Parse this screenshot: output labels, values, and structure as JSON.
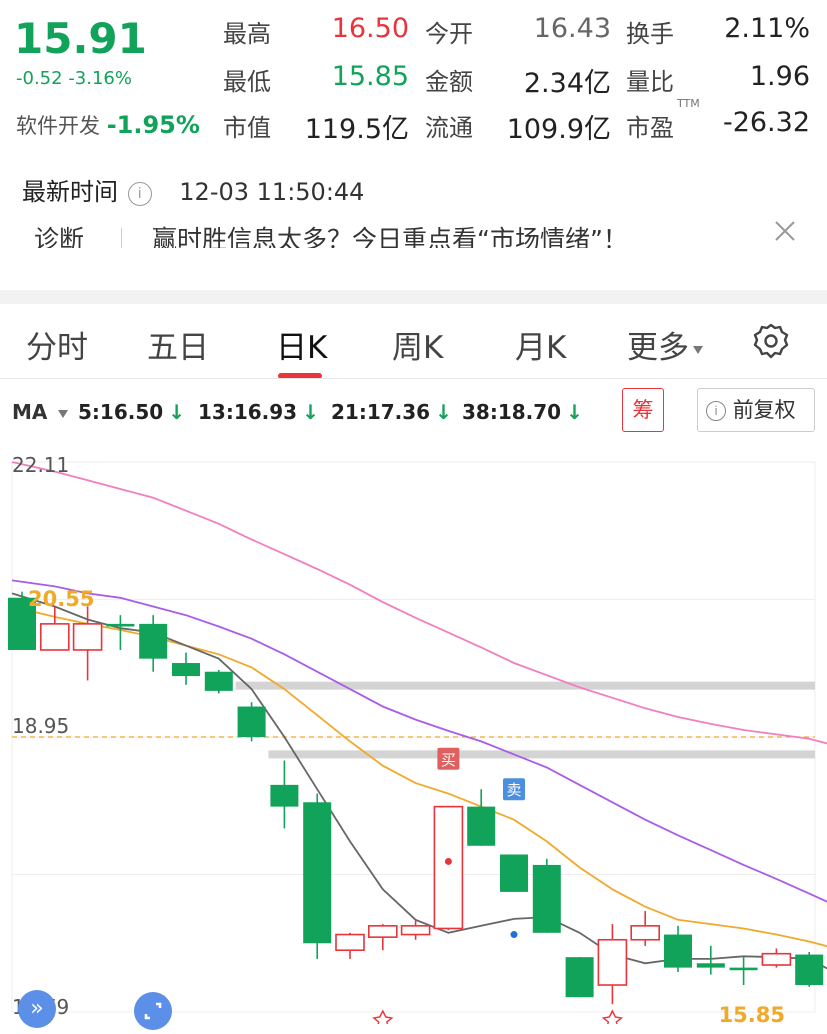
{
  "quote": {
    "price": "15.91",
    "change": "-0.52",
    "change_pct": "-3.16%",
    "sector_name": "软件开发",
    "sector_change": "-1.95%",
    "grid": [
      {
        "label": "最高",
        "value": "16.50",
        "tone": "red"
      },
      {
        "label": "今开",
        "value": "16.43",
        "tone": "grey"
      },
      {
        "label": "换手",
        "value": "2.11%",
        "tone": "dark"
      },
      {
        "label": "最低",
        "value": "15.85",
        "tone": "green"
      },
      {
        "label": "金额",
        "value": "2.34亿",
        "tone": "dark"
      },
      {
        "label": "量比",
        "value": "1.96",
        "tone": "dark"
      },
      {
        "label": "市值",
        "value": "119.5亿",
        "tone": "dark"
      },
      {
        "label": "流通",
        "value": "109.9亿",
        "tone": "dark"
      },
      {
        "label": "市盈",
        "value": "-26.32",
        "tone": "dark"
      }
    ],
    "pe_suffix": "TTM"
  },
  "latest_time": {
    "label": "最新时间",
    "value": "12-03 11:50:44"
  },
  "notice": {
    "tag": "诊断",
    "text": "赢时胜信息太多？今日重点看“市场情绪”！"
  },
  "tabs": [
    "分时",
    "五日",
    "日K",
    "周K",
    "月K",
    "更多"
  ],
  "active_tab": 2,
  "ma_bar": {
    "label": "MA",
    "items": [
      {
        "text": "5:16.50",
        "color": "#333333"
      },
      {
        "text": "13:16.93",
        "color": "#f0a92a"
      },
      {
        "text": "21:17.36",
        "color": "#a95ce6"
      },
      {
        "text": "38:18.70",
        "color": "#f07fc0"
      }
    ],
    "chip_label": "筹",
    "fq_label": "前复权"
  },
  "chart_data": {
    "type": "candlestick",
    "y_axis_ticks": [
      "22.11",
      "18.95",
      "15.79"
    ],
    "ylim": [
      15.79,
      22.11
    ],
    "max_label": "20.55",
    "min_label": "15.85",
    "reference_line": 18.95,
    "up_color": "#e8343a",
    "down_color": "#11a35a",
    "candles": [
      {
        "o": 20.55,
        "h": 20.62,
        "c": 19.95,
        "l": 19.95
      },
      {
        "o": 19.95,
        "h": 20.45,
        "c": 20.25,
        "l": 19.95
      },
      {
        "o": 19.95,
        "h": 20.45,
        "c": 20.25,
        "l": 19.6
      },
      {
        "o": 20.25,
        "h": 20.35,
        "c": 20.22,
        "l": 19.95
      },
      {
        "o": 20.25,
        "h": 20.35,
        "c": 19.85,
        "l": 19.7
      },
      {
        "o": 19.8,
        "h": 19.92,
        "c": 19.65,
        "l": 19.55
      },
      {
        "o": 19.7,
        "h": 19.72,
        "c": 19.48,
        "l": 19.45
      },
      {
        "o": 19.3,
        "h": 19.35,
        "c": 18.95,
        "l": 18.9
      },
      {
        "o": 18.4,
        "h": 18.68,
        "c": 18.15,
        "l": 17.9
      },
      {
        "o": 18.2,
        "h": 18.3,
        "c": 16.58,
        "l": 16.4
      },
      {
        "o": 16.5,
        "h": 16.7,
        "c": 16.68,
        "l": 16.4
      },
      {
        "o": 16.65,
        "h": 16.8,
        "c": 16.78,
        "l": 16.5
      },
      {
        "o": 16.68,
        "h": 16.84,
        "c": 16.78,
        "l": 16.62
      },
      {
        "o": 16.75,
        "h": 18.15,
        "c": 18.15,
        "l": 16.73
      },
      {
        "o": 18.15,
        "h": 18.35,
        "c": 17.7,
        "l": 17.7
      },
      {
        "o": 17.6,
        "h": 17.6,
        "c": 17.17,
        "l": 17.17
      },
      {
        "o": 17.48,
        "h": 17.55,
        "c": 16.7,
        "l": 16.7
      },
      {
        "o": 16.42,
        "h": 16.42,
        "c": 15.96,
        "l": 15.96
      },
      {
        "o": 16.1,
        "h": 16.8,
        "c": 16.62,
        "l": 15.88
      },
      {
        "o": 16.62,
        "h": 16.95,
        "c": 16.78,
        "l": 16.55
      },
      {
        "o": 16.68,
        "h": 16.78,
        "c": 16.3,
        "l": 16.25
      },
      {
        "o": 16.35,
        "h": 16.55,
        "c": 16.3,
        "l": 16.22
      },
      {
        "o": 16.3,
        "h": 16.42,
        "c": 16.27,
        "l": 16.1
      },
      {
        "o": 16.33,
        "h": 16.52,
        "c": 16.46,
        "l": 16.3
      },
      {
        "o": 16.45,
        "h": 16.48,
        "c": 16.1,
        "l": 16.08
      },
      {
        "o": 15.95,
        "h": 16.05,
        "c": 15.5,
        "l": 15.5
      }
    ],
    "ma5": [
      20.6,
      20.45,
      20.3,
      20.2,
      20.15,
      20.0,
      19.85,
      19.5,
      18.95,
      18.35,
      17.75,
      17.2,
      16.85,
      16.7,
      16.78,
      16.86,
      16.88,
      16.7,
      16.45,
      16.35,
      16.4,
      16.4,
      16.43,
      16.42,
      16.4,
      16.2
    ],
    "ma13": [
      20.45,
      20.33,
      20.25,
      20.18,
      20.1,
      20.0,
      19.9,
      19.75,
      19.5,
      19.2,
      18.9,
      18.62,
      18.42,
      18.3,
      18.15,
      18.0,
      17.75,
      17.45,
      17.2,
      17.0,
      16.85,
      16.8,
      16.75,
      16.68,
      16.6,
      16.5
    ],
    "ma21": [
      20.75,
      20.68,
      20.6,
      20.55,
      20.45,
      20.35,
      20.22,
      20.08,
      19.9,
      19.7,
      19.5,
      19.3,
      19.15,
      19.02,
      18.9,
      18.75,
      18.6,
      18.4,
      18.2,
      18.0,
      17.82,
      17.65,
      17.48,
      17.32,
      17.15,
      16.98
    ],
    "ma38": [
      22.11,
      22.0,
      21.9,
      21.8,
      21.7,
      21.55,
      21.4,
      21.22,
      21.05,
      20.88,
      20.7,
      20.5,
      20.32,
      20.15,
      19.98,
      19.8,
      19.66,
      19.52,
      19.4,
      19.28,
      19.18,
      19.1,
      19.03,
      18.98,
      18.93,
      18.83
    ],
    "bands": [
      {
        "price": 19.54,
        "from": 7
      },
      {
        "price": 18.75,
        "from": 8
      }
    ],
    "signals": [
      {
        "label": "买",
        "index": 13,
        "price": 18.7,
        "color": "#e06060"
      },
      {
        "label": "卖",
        "index": 15,
        "price": 18.35,
        "color": "#4a8fe0"
      }
    ],
    "dots": [
      {
        "index": 13,
        "price": 17.52,
        "color": "#e8343a"
      },
      {
        "index": 15,
        "price": 16.68,
        "color": "#1e6fd8"
      }
    ],
    "stars_at": [
      11,
      18
    ]
  }
}
